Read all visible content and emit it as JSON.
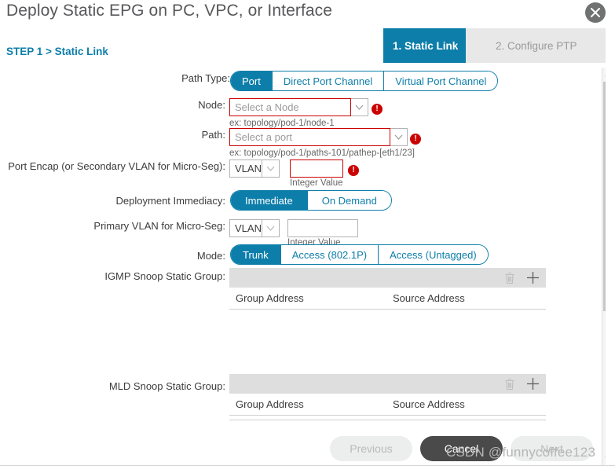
{
  "dialog": {
    "title": "Deploy Static EPG on PC, VPC, or Interface",
    "close_icon": "close-icon",
    "step_label": "STEP 1 > Static Link",
    "accent_color": "#0d7eaa",
    "error_color": "#cc0000"
  },
  "steps": [
    {
      "label": "1. Static Link",
      "state": "active"
    },
    {
      "label": "2. Configure PTP",
      "state": "inactive"
    }
  ],
  "form": {
    "path_type": {
      "label": "Path Type:",
      "options": [
        "Port",
        "Direct Port Channel",
        "Virtual Port Channel"
      ],
      "selected": "Port"
    },
    "node": {
      "label": "Node:",
      "placeholder": "Select a Node",
      "value": "",
      "hint": "ex: topology/pod-1/node-1",
      "error": true,
      "error_icon": "!"
    },
    "path": {
      "label": "Path:",
      "placeholder": "Select a port",
      "value": "",
      "hint": "ex: topology/pod-1/paths-101/pathep-[eth1/23]",
      "error": true,
      "error_icon": "!"
    },
    "port_encap": {
      "label": "Port Encap (or Secondary VLAN for Micro-Seg):",
      "select_value": "VLAN",
      "input_value": "",
      "hint": "Integer Value",
      "error": true,
      "error_icon": "!"
    },
    "deployment_immediacy": {
      "label": "Deployment Immediacy:",
      "options": [
        "Immediate",
        "On Demand"
      ],
      "selected": "Immediate"
    },
    "primary_vlan": {
      "label": "Primary VLAN for Micro-Seg:",
      "select_value": "VLAN",
      "input_value": "",
      "hint": "Integer Value"
    },
    "mode": {
      "label": "Mode:",
      "options": [
        "Trunk",
        "Access (802.1P)",
        "Access (Untagged)"
      ],
      "selected": "Trunk"
    },
    "igmp_group": {
      "label": "IGMP Snoop Static Group:",
      "delete_icon": "trash-icon",
      "add_icon": "plus-icon",
      "columns": [
        "Group Address",
        "Source Address"
      ],
      "rows": []
    },
    "mld_group": {
      "label": "MLD Snoop Static Group:",
      "delete_icon": "trash-icon",
      "add_icon": "plus-icon",
      "columns": [
        "Group Address",
        "Source Address"
      ],
      "rows": []
    }
  },
  "footer": {
    "previous": "Previous",
    "cancel": "Cancel",
    "next": "Next"
  },
  "scrollbar": {
    "up_icon": "chevron-up-icon",
    "down_icon": "chevron-down-icon"
  },
  "watermark": "CSDN @funnycoffee123"
}
